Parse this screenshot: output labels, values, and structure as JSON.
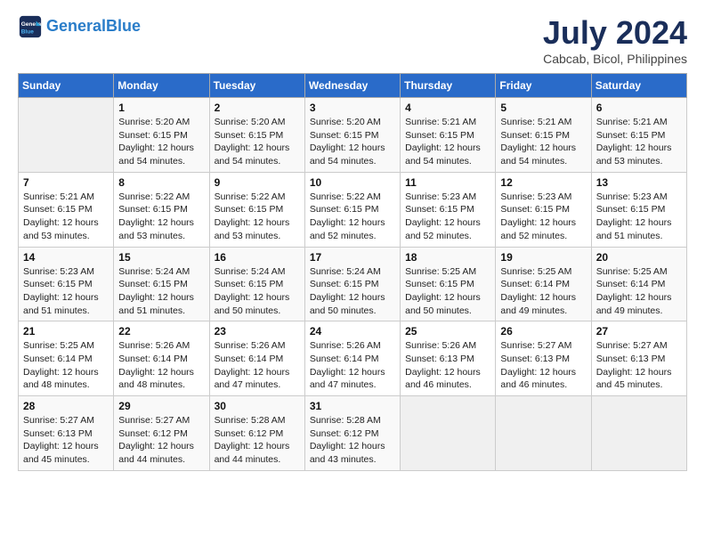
{
  "logo": {
    "line1": "General",
    "line2": "Blue"
  },
  "title": "July 2024",
  "subtitle": "Cabcab, Bicol, Philippines",
  "days_header": [
    "Sunday",
    "Monday",
    "Tuesday",
    "Wednesday",
    "Thursday",
    "Friday",
    "Saturday"
  ],
  "weeks": [
    [
      {
        "day": "",
        "info": ""
      },
      {
        "day": "1",
        "info": "Sunrise: 5:20 AM\nSunset: 6:15 PM\nDaylight: 12 hours\nand 54 minutes."
      },
      {
        "day": "2",
        "info": "Sunrise: 5:20 AM\nSunset: 6:15 PM\nDaylight: 12 hours\nand 54 minutes."
      },
      {
        "day": "3",
        "info": "Sunrise: 5:20 AM\nSunset: 6:15 PM\nDaylight: 12 hours\nand 54 minutes."
      },
      {
        "day": "4",
        "info": "Sunrise: 5:21 AM\nSunset: 6:15 PM\nDaylight: 12 hours\nand 54 minutes."
      },
      {
        "day": "5",
        "info": "Sunrise: 5:21 AM\nSunset: 6:15 PM\nDaylight: 12 hours\nand 54 minutes."
      },
      {
        "day": "6",
        "info": "Sunrise: 5:21 AM\nSunset: 6:15 PM\nDaylight: 12 hours\nand 53 minutes."
      }
    ],
    [
      {
        "day": "7",
        "info": "Sunrise: 5:21 AM\nSunset: 6:15 PM\nDaylight: 12 hours\nand 53 minutes."
      },
      {
        "day": "8",
        "info": "Sunrise: 5:22 AM\nSunset: 6:15 PM\nDaylight: 12 hours\nand 53 minutes."
      },
      {
        "day": "9",
        "info": "Sunrise: 5:22 AM\nSunset: 6:15 PM\nDaylight: 12 hours\nand 53 minutes."
      },
      {
        "day": "10",
        "info": "Sunrise: 5:22 AM\nSunset: 6:15 PM\nDaylight: 12 hours\nand 52 minutes."
      },
      {
        "day": "11",
        "info": "Sunrise: 5:23 AM\nSunset: 6:15 PM\nDaylight: 12 hours\nand 52 minutes."
      },
      {
        "day": "12",
        "info": "Sunrise: 5:23 AM\nSunset: 6:15 PM\nDaylight: 12 hours\nand 52 minutes."
      },
      {
        "day": "13",
        "info": "Sunrise: 5:23 AM\nSunset: 6:15 PM\nDaylight: 12 hours\nand 51 minutes."
      }
    ],
    [
      {
        "day": "14",
        "info": "Sunrise: 5:23 AM\nSunset: 6:15 PM\nDaylight: 12 hours\nand 51 minutes."
      },
      {
        "day": "15",
        "info": "Sunrise: 5:24 AM\nSunset: 6:15 PM\nDaylight: 12 hours\nand 51 minutes."
      },
      {
        "day": "16",
        "info": "Sunrise: 5:24 AM\nSunset: 6:15 PM\nDaylight: 12 hours\nand 50 minutes."
      },
      {
        "day": "17",
        "info": "Sunrise: 5:24 AM\nSunset: 6:15 PM\nDaylight: 12 hours\nand 50 minutes."
      },
      {
        "day": "18",
        "info": "Sunrise: 5:25 AM\nSunset: 6:15 PM\nDaylight: 12 hours\nand 50 minutes."
      },
      {
        "day": "19",
        "info": "Sunrise: 5:25 AM\nSunset: 6:14 PM\nDaylight: 12 hours\nand 49 minutes."
      },
      {
        "day": "20",
        "info": "Sunrise: 5:25 AM\nSunset: 6:14 PM\nDaylight: 12 hours\nand 49 minutes."
      }
    ],
    [
      {
        "day": "21",
        "info": "Sunrise: 5:25 AM\nSunset: 6:14 PM\nDaylight: 12 hours\nand 48 minutes."
      },
      {
        "day": "22",
        "info": "Sunrise: 5:26 AM\nSunset: 6:14 PM\nDaylight: 12 hours\nand 48 minutes."
      },
      {
        "day": "23",
        "info": "Sunrise: 5:26 AM\nSunset: 6:14 PM\nDaylight: 12 hours\nand 47 minutes."
      },
      {
        "day": "24",
        "info": "Sunrise: 5:26 AM\nSunset: 6:14 PM\nDaylight: 12 hours\nand 47 minutes."
      },
      {
        "day": "25",
        "info": "Sunrise: 5:26 AM\nSunset: 6:13 PM\nDaylight: 12 hours\nand 46 minutes."
      },
      {
        "day": "26",
        "info": "Sunrise: 5:27 AM\nSunset: 6:13 PM\nDaylight: 12 hours\nand 46 minutes."
      },
      {
        "day": "27",
        "info": "Sunrise: 5:27 AM\nSunset: 6:13 PM\nDaylight: 12 hours\nand 45 minutes."
      }
    ],
    [
      {
        "day": "28",
        "info": "Sunrise: 5:27 AM\nSunset: 6:13 PM\nDaylight: 12 hours\nand 45 minutes."
      },
      {
        "day": "29",
        "info": "Sunrise: 5:27 AM\nSunset: 6:12 PM\nDaylight: 12 hours\nand 44 minutes."
      },
      {
        "day": "30",
        "info": "Sunrise: 5:28 AM\nSunset: 6:12 PM\nDaylight: 12 hours\nand 44 minutes."
      },
      {
        "day": "31",
        "info": "Sunrise: 5:28 AM\nSunset: 6:12 PM\nDaylight: 12 hours\nand 43 minutes."
      },
      {
        "day": "",
        "info": ""
      },
      {
        "day": "",
        "info": ""
      },
      {
        "day": "",
        "info": ""
      }
    ]
  ]
}
